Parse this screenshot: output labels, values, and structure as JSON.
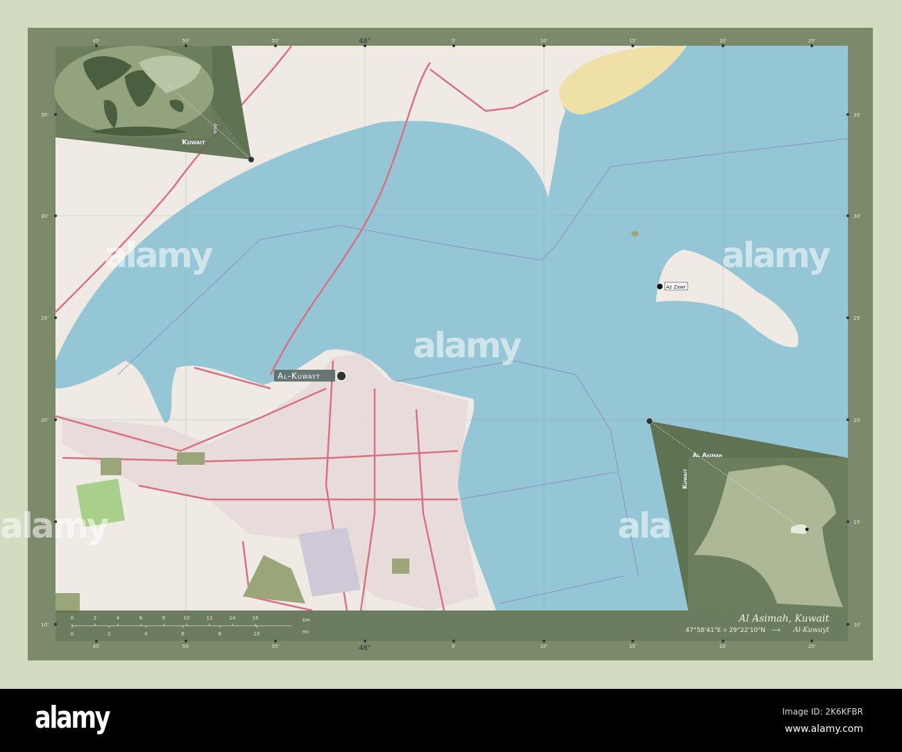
{
  "map": {
    "title": "Al Asimah, Kuwait",
    "coordinates": "47°58'41\"E ⟡ 29°22'10\"N",
    "arrow": "⟶",
    "capital_ref": "Al-Kuwayt",
    "colors": {
      "land": "#efebe4",
      "water": "#94c6d6",
      "road": "#d9707f",
      "sand": "#eee0a6",
      "frame": "#7a8a6a",
      "inset": "#5f7352",
      "highlight": "#adb896"
    },
    "places": {
      "capital": "Al-Kuwayt",
      "island_town": "Az Zawr"
    },
    "inset_world": {
      "country": "Kuwait",
      "continent": "Asia"
    },
    "inset_country": {
      "region": "Al Asimah",
      "country": "Kuwait"
    },
    "ticks": {
      "top": [
        "45'",
        "50'",
        "55'",
        "48°",
        "5'",
        "10'",
        "15'",
        "20'",
        "25'"
      ],
      "left": [
        "35'",
        "30'",
        "25'",
        "20'",
        "15'",
        "10'"
      ],
      "right": [
        "35'",
        "30'",
        "25'",
        "20'",
        "15'",
        "10'"
      ]
    },
    "scale_bar": {
      "km_label": "km",
      "mi_label": "mi",
      "km_ticks": [
        "0",
        "2",
        "4",
        "6",
        "8",
        "10",
        "12",
        "14",
        "16"
      ],
      "mi_ticks": [
        "0",
        "2",
        "4",
        "6",
        "8",
        "10"
      ]
    },
    "watermark": "alamy"
  },
  "footer": {
    "logo": "alamy",
    "image_id": "Image ID: 2K6KFBR",
    "url": "www.alamy.com"
  }
}
